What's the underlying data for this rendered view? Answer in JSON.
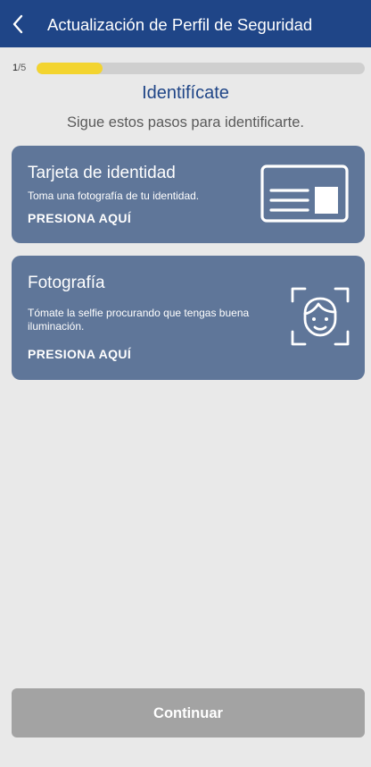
{
  "header": {
    "title": "Actualización de Perfil de Seguridad",
    "back_icon": "chevron-left-icon"
  },
  "progress": {
    "current": "1",
    "total": "/5",
    "fraction": 0.2,
    "fill_color": "#f3d42f"
  },
  "main": {
    "title": "Identifícate",
    "subtitle": "Sigue estos pasos para identificarte."
  },
  "cards": [
    {
      "title": "Tarjeta de identidad",
      "description": "Toma una fotografía de tu identidad.",
      "action": "PRESIONA AQUÍ",
      "icon": "id-card-icon"
    },
    {
      "title": "Fotografía",
      "description": "Tómate la selfie procurando que tengas buena iluminación.",
      "action": "PRESIONA AQUÍ",
      "icon": "face-scan-icon"
    }
  ],
  "footer": {
    "continue_label": "Continuar"
  },
  "colors": {
    "header": "#1f4587",
    "card": "#5f7699",
    "background": "#e9e9e9",
    "button_disabled": "#a3a3a3"
  }
}
